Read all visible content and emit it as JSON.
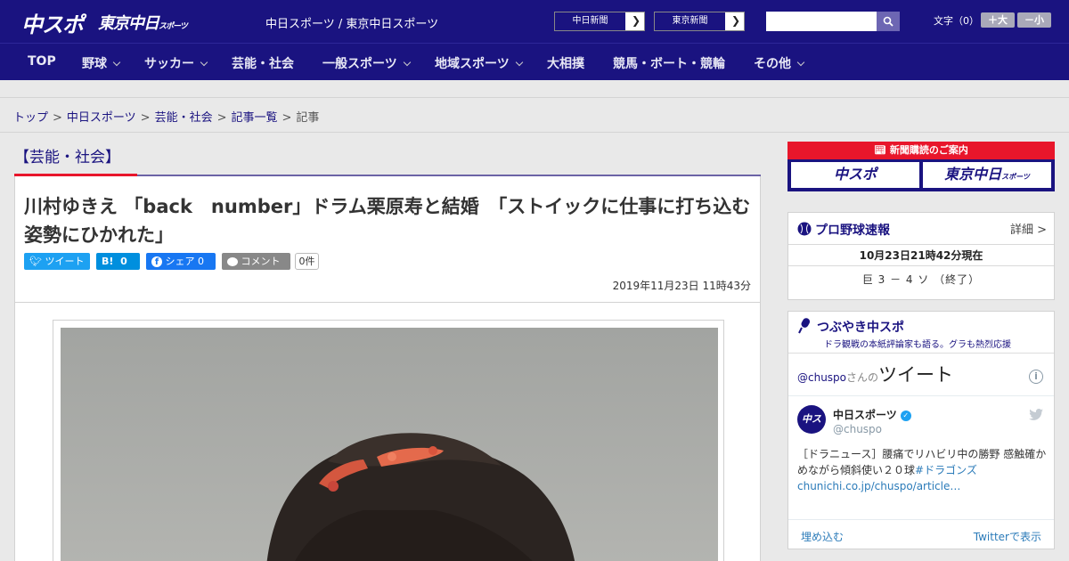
{
  "header": {
    "logo_main": "中スポ",
    "logo_tokyo": "東京中日",
    "logo_tokyo_small": "スポーツ",
    "site_name": "中日スポーツ / 東京中日スポーツ",
    "paper_links": [
      "中日新聞",
      "東京新聞"
    ],
    "search_placeholder": "",
    "text_size_label": "文字（0）",
    "text_size_up": "＋大",
    "text_size_down": "－小"
  },
  "nav": {
    "items": [
      {
        "label": "TOP",
        "has_dropdown": false
      },
      {
        "label": "野球",
        "has_dropdown": true
      },
      {
        "label": "サッカー",
        "has_dropdown": true
      },
      {
        "label": "芸能・社会",
        "has_dropdown": false
      },
      {
        "label": "一般スポーツ",
        "has_dropdown": true
      },
      {
        "label": "地域スポーツ",
        "has_dropdown": true
      },
      {
        "label": "大相撲",
        "has_dropdown": false
      },
      {
        "label": "競馬・ボート・競輪",
        "has_dropdown": false
      },
      {
        "label": "その他",
        "has_dropdown": true
      }
    ]
  },
  "breadcrumb": {
    "items": [
      "トップ",
      "中日スポーツ",
      "芸能・社会",
      "記事一覧"
    ],
    "current": "記事",
    "separator": ">"
  },
  "article": {
    "category": "【芸能・社会】",
    "headline": "川村ゆきえ 「back　number」ドラム栗原寿と結婚　「ストイックに仕事に打ち込む姿勢にひかれた」",
    "date": "2019年11月23日 11時43分",
    "share": {
      "tweet": "ツイート",
      "hatena_icon": "B!",
      "hatena_count": "0",
      "facebook": "シェア",
      "facebook_count": "0",
      "comment": "コメント",
      "comment_count": "0件"
    }
  },
  "sidebar": {
    "subscription": {
      "title": "新聞購読のご案内",
      "logo_1": "中スポ",
      "logo_2": "東京中日",
      "logo_2_small": "スポーツ"
    },
    "baseball": {
      "title": "プロ野球速報",
      "detail": "詳細 >",
      "timestamp": "10月23日21時42分現在",
      "score": "巨 3 － 4 ソ （終了）"
    },
    "tweets": {
      "title": "つぶやき中スポ",
      "subtitle": "ドラ観戦の本紙評論家も語る。グラも熱烈応援",
      "by_handle": "@chuspo",
      "by_suffix": "さんの",
      "by_label": "ツイート",
      "info_icon": "i",
      "author_name": "中日スポーツ",
      "author_handle": "@chuspo",
      "avatar_text": "中スポ",
      "text_1": "［ドラニュース］腰痛でリハビリ中の勝野 感触確かめながら傾斜使い２０球",
      "hashtag": "#ドラゴンズ",
      "link": "chunichi.co.jp/chuspo/article…",
      "embed": "埋め込む",
      "view_on": "Twitterで表示"
    }
  },
  "colors": {
    "brand": "#1a1380",
    "accent_red": "#e8162b",
    "twitter": "#1da1f2",
    "facebook": "#1877f2",
    "hatena": "#008fde"
  }
}
